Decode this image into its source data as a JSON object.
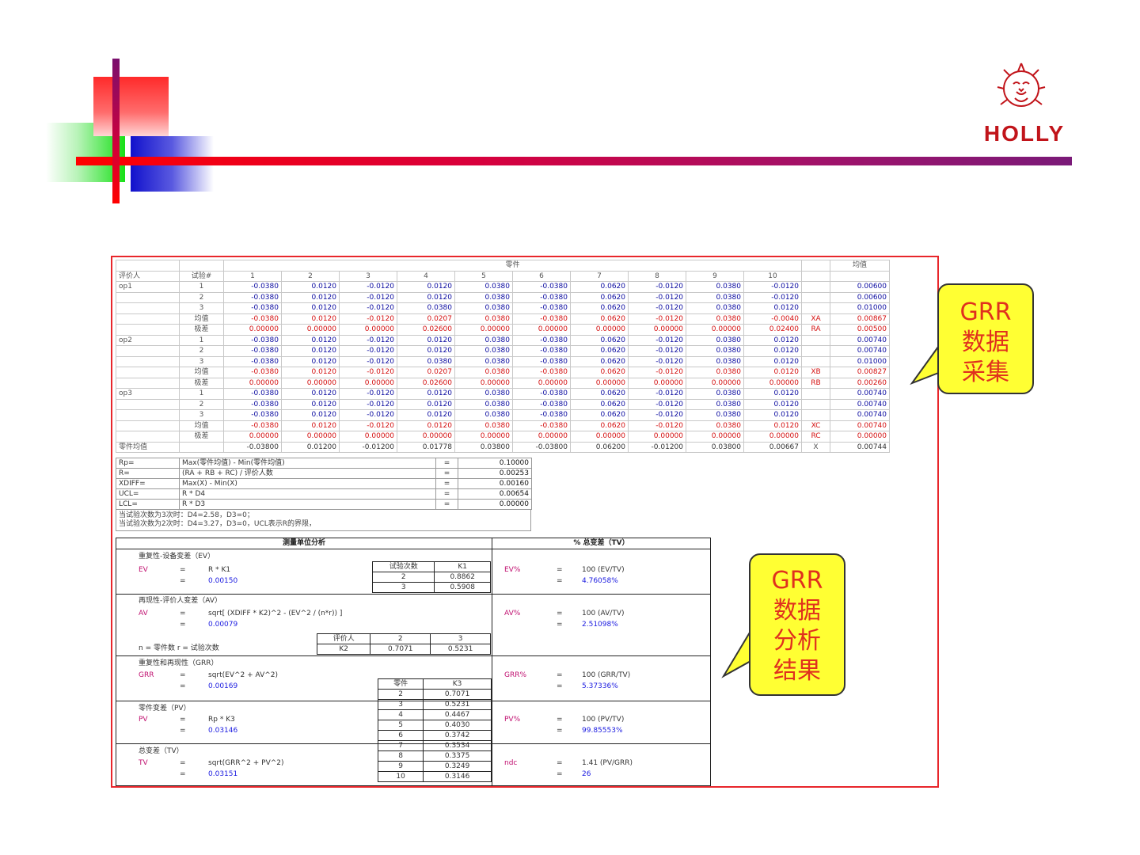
{
  "logo": {
    "text": "HOLLY"
  },
  "grid": {
    "part_header": "零件",
    "mean_header": "均值",
    "col_appraiser": "评价人",
    "col_trial": "试验#",
    "parts": [
      "1",
      "2",
      "3",
      "4",
      "5",
      "6",
      "7",
      "8",
      "9",
      "10"
    ],
    "rows": [
      {
        "op": "op1",
        "trial": "1",
        "vals": [
          "-0.0380",
          "0.0120",
          "-0.0120",
          "0.0120",
          "0.0380",
          "-0.0380",
          "0.0620",
          "-0.0120",
          "0.0380",
          "-0.0120"
        ],
        "tag": "",
        "mean": "0.00600",
        "style": "blue"
      },
      {
        "op": "",
        "trial": "2",
        "vals": [
          "-0.0380",
          "0.0120",
          "-0.0120",
          "0.0120",
          "0.0380",
          "-0.0380",
          "0.0620",
          "-0.0120",
          "0.0380",
          "-0.0120"
        ],
        "tag": "",
        "mean": "0.00600",
        "style": "blue"
      },
      {
        "op": "",
        "trial": "3",
        "vals": [
          "-0.0380",
          "0.0120",
          "-0.0120",
          "0.0380",
          "0.0380",
          "-0.0380",
          "0.0620",
          "-0.0120",
          "0.0380",
          "0.0120"
        ],
        "tag": "",
        "mean": "0.01000",
        "style": "blue"
      },
      {
        "op": "",
        "trial": "均值",
        "vals": [
          "-0.0380",
          "0.0120",
          "-0.0120",
          "0.0207",
          "0.0380",
          "-0.0380",
          "0.0620",
          "-0.0120",
          "0.0380",
          "-0.0040"
        ],
        "tag": "XA",
        "mean": "0.00867",
        "style": "red"
      },
      {
        "op": "",
        "trial": "极差",
        "vals": [
          "0.00000",
          "0.00000",
          "0.00000",
          "0.02600",
          "0.00000",
          "0.00000",
          "0.00000",
          "0.00000",
          "0.00000",
          "0.02400"
        ],
        "tag": "RA",
        "mean": "0.00500",
        "style": "red"
      },
      {
        "op": "op2",
        "trial": "1",
        "vals": [
          "-0.0380",
          "0.0120",
          "-0.0120",
          "0.0120",
          "0.0380",
          "-0.0380",
          "0.0620",
          "-0.0120",
          "0.0380",
          "0.0120"
        ],
        "tag": "",
        "mean": "0.00740",
        "style": "blue"
      },
      {
        "op": "",
        "trial": "2",
        "vals": [
          "-0.0380",
          "0.0120",
          "-0.0120",
          "0.0120",
          "0.0380",
          "-0.0380",
          "0.0620",
          "-0.0120",
          "0.0380",
          "0.0120"
        ],
        "tag": "",
        "mean": "0.00740",
        "style": "blue"
      },
      {
        "op": "",
        "trial": "3",
        "vals": [
          "-0.0380",
          "0.0120",
          "-0.0120",
          "0.0380",
          "0.0380",
          "-0.0380",
          "0.0620",
          "-0.0120",
          "0.0380",
          "0.0120"
        ],
        "tag": "",
        "mean": "0.01000",
        "style": "blue"
      },
      {
        "op": "",
        "trial": "均值",
        "vals": [
          "-0.0380",
          "0.0120",
          "-0.0120",
          "0.0207",
          "0.0380",
          "-0.0380",
          "0.0620",
          "-0.0120",
          "0.0380",
          "0.0120"
        ],
        "tag": "XB",
        "mean": "0.00827",
        "style": "red"
      },
      {
        "op": "",
        "trial": "极差",
        "vals": [
          "0.00000",
          "0.00000",
          "0.00000",
          "0.02600",
          "0.00000",
          "0.00000",
          "0.00000",
          "0.00000",
          "0.00000",
          "0.00000"
        ],
        "tag": "RB",
        "mean": "0.00260",
        "style": "red"
      },
      {
        "op": "op3",
        "trial": "1",
        "vals": [
          "-0.0380",
          "0.0120",
          "-0.0120",
          "0.0120",
          "0.0380",
          "-0.0380",
          "0.0620",
          "-0.0120",
          "0.0380",
          "0.0120"
        ],
        "tag": "",
        "mean": "0.00740",
        "style": "blue"
      },
      {
        "op": "",
        "trial": "2",
        "vals": [
          "-0.0380",
          "0.0120",
          "-0.0120",
          "0.0120",
          "0.0380",
          "-0.0380",
          "0.0620",
          "-0.0120",
          "0.0380",
          "0.0120"
        ],
        "tag": "",
        "mean": "0.00740",
        "style": "blue"
      },
      {
        "op": "",
        "trial": "3",
        "vals": [
          "-0.0380",
          "0.0120",
          "-0.0120",
          "0.0120",
          "0.0380",
          "-0.0380",
          "0.0620",
          "-0.0120",
          "0.0380",
          "0.0120"
        ],
        "tag": "",
        "mean": "0.00740",
        "style": "blue"
      },
      {
        "op": "",
        "trial": "均值",
        "vals": [
          "-0.0380",
          "0.0120",
          "-0.0120",
          "0.0120",
          "0.0380",
          "-0.0380",
          "0.0620",
          "-0.0120",
          "0.0380",
          "0.0120"
        ],
        "tag": "XC",
        "mean": "0.00740",
        "style": "red"
      },
      {
        "op": "",
        "trial": "极差",
        "vals": [
          "0.00000",
          "0.00000",
          "0.00000",
          "0.00000",
          "0.00000",
          "0.00000",
          "0.00000",
          "0.00000",
          "0.00000",
          "0.00000"
        ],
        "tag": "RC",
        "mean": "0.00000",
        "style": "red"
      },
      {
        "op": "零件均值",
        "trial": "",
        "vals": [
          "-0.03800",
          "0.01200",
          "-0.01200",
          "0.01778",
          "0.03800",
          "-0.03800",
          "0.06200",
          "-0.01200",
          "0.03800",
          "0.00667"
        ],
        "tag": "X",
        "mean": "0.00744",
        "style": "black"
      }
    ]
  },
  "formulas": {
    "rows": [
      {
        "name": "Rp=",
        "expr": "Max(零件均值) - Min(零件均值)",
        "eq": "=",
        "val": "0.10000"
      },
      {
        "name": "R=",
        "expr": "(RA + RB + RC) / 评价人数",
        "eq": "=",
        "val": "0.00253"
      },
      {
        "name": "XDIFF=",
        "expr": "Max(X) - Min(X)",
        "eq": "=",
        "val": "0.00160"
      },
      {
        "name": "UCL=",
        "expr": "R * D4",
        "eq": "=",
        "val": "0.00654"
      },
      {
        "name": "LCL=",
        "expr": "R * D3",
        "eq": "=",
        "val": "0.00000"
      }
    ],
    "note1": "当试验次数为3次时：D4=2.58，D3=0；",
    "note2": "当试验次数为2次时：D4=3.27，D3=0，UCL表示R的界限，"
  },
  "analysis": {
    "left_title": "测量单位分析",
    "right_title": "%    总变差（TV）",
    "ev": {
      "title": "重复性-设备变差（EV）",
      "name": "EV",
      "eq": "=",
      "formula": "R * K1",
      "eq2": "=",
      "value": "0.00150",
      "k_head": [
        "试验次数",
        "K1"
      ],
      "k_rows": [
        [
          "2",
          "0.8862"
        ],
        [
          "3",
          "0.5908"
        ]
      ],
      "pct_name": "EV%",
      "pct_eq": "=",
      "pct_formula": "100 (EV/TV)",
      "pct_eq2": "=",
      "pct_value": "4.76058%"
    },
    "av": {
      "title": "再现性-评价人变差（AV）",
      "name": "AV",
      "eq": "=",
      "formula": "sqrt[ (XDIFF * K2)^2 - (EV^2 / (n*r)) ]",
      "eq2": "=",
      "value": "0.00079",
      "nr_note": "n = 零件数    r = 试验次数",
      "k_head": [
        "评价人",
        "2",
        "3"
      ],
      "k_row": [
        "K2",
        "0.7071",
        "0.5231"
      ],
      "pct_name": "AV%",
      "pct_eq": "=",
      "pct_formula": "100 (AV/TV)",
      "pct_eq2": "=",
      "pct_value": "2.51098%"
    },
    "grr": {
      "title": "重复性和再现性（GRR）",
      "name": "GRR",
      "eq": "=",
      "formula": "sqrt(EV^2 + AV^2)",
      "eq2": "=",
      "value": "0.00169",
      "pct_name": "GRR%",
      "pct_eq": "=",
      "pct_formula": "100 (GRR/TV)",
      "pct_eq2": "=",
      "pct_value": "5.37336%"
    },
    "k3": {
      "head": [
        "零件",
        "K3"
      ],
      "rows": [
        [
          "2",
          "0.7071"
        ],
        [
          "3",
          "0.5231"
        ],
        [
          "4",
          "0.4467"
        ],
        [
          "5",
          "0.4030"
        ],
        [
          "6",
          "0.3742"
        ],
        [
          "7",
          "0.3534"
        ],
        [
          "8",
          "0.3375"
        ],
        [
          "9",
          "0.3249"
        ],
        [
          "10",
          "0.3146"
        ]
      ]
    },
    "pv": {
      "title": "零件变差（PV）",
      "name": "PV",
      "eq": "=",
      "formula": "Rp * K3",
      "eq2": "=",
      "value": "0.03146",
      "pct_name": "PV%",
      "pct_eq": "=",
      "pct_formula": "100 (PV/TV)",
      "pct_eq2": "=",
      "pct_value": "99.85553%"
    },
    "tv": {
      "title": "总变差（TV）",
      "name": "TV",
      "eq": "=",
      "formula": "sqrt(GRR^2 + PV^2)",
      "eq2": "=",
      "value": "0.03151",
      "pct_name": "ndc",
      "pct_eq": "=",
      "pct_formula": "1.41 (PV/GRR)",
      "pct_eq2": "=",
      "pct_value": "26"
    }
  },
  "callouts": {
    "c1": [
      "GRR",
      "数据",
      "采集"
    ],
    "c2": [
      "GRR",
      "数据",
      "分析",
      "结果"
    ]
  }
}
